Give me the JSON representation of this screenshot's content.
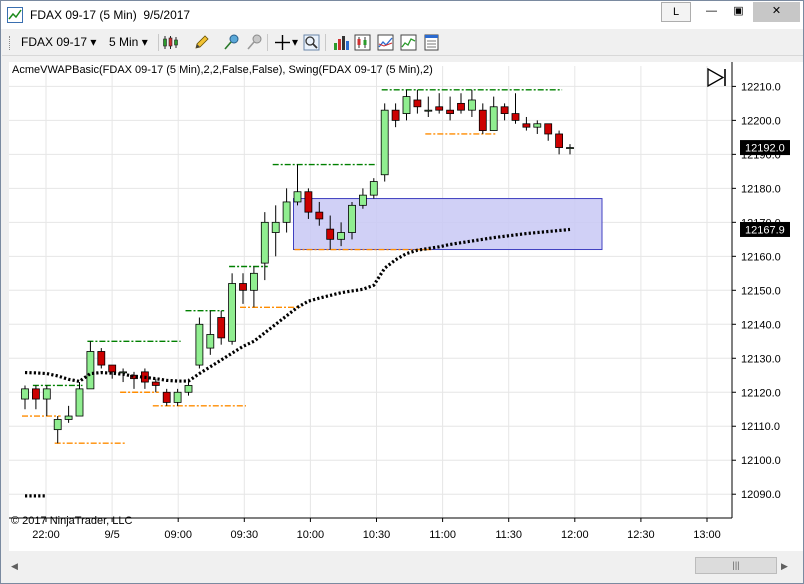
{
  "window": {
    "title_instrument": "FDAX 09-17 (5 Min)",
    "title_date": "9/5/2017",
    "button_l": "L",
    "minimize_glyph": "—",
    "maximize_glyph": "▣",
    "close_glyph": "✕"
  },
  "toolbar": {
    "instrument_label": "FDAX 09-17",
    "interval_label": "5 Min",
    "dropdown_glyph": "▾",
    "icons": [
      "candlestick-style-icon",
      "pencil-draw-icon",
      "pin-icon",
      "hide-draw-icon",
      "crosshair-icon",
      "zoom-icon",
      "bar-data-icon",
      "indicators-icon",
      "strategies-icon",
      "properties-icon"
    ]
  },
  "chart": {
    "indicator_label": "AcmeVWAPBasic(FDAX 09-17 (5 Min),2,2,False,False), Swing(FDAX 09-17 (5 Min),2)",
    "copyright": "© 2017 NinjaTrader, LLC",
    "last_price_label": "12192.0",
    "vwap_price_label": "12167.9",
    "colors": {
      "up_candle": "#90ee90",
      "down_candle": "#cc0000",
      "swing_high": "#008000",
      "swing_low": "#ff8c00",
      "vwap": "#000000",
      "zone_fill": "#c8c8f5",
      "zone_border": "#4040c0",
      "grid": "#e6e6e6"
    }
  },
  "chart_data": {
    "type": "candlestick",
    "instrument": "FDAX 09-17",
    "interval": "5 Min",
    "y_ticks": [
      12090,
      12100,
      12110,
      12120,
      12130,
      12140,
      12150,
      12160,
      12170,
      12180,
      12190,
      12200,
      12210
    ],
    "y_tick_labels": [
      "12090.0",
      "12100.0",
      "12110.0",
      "12120.0",
      "12130.0",
      "12140.0",
      "12150.0",
      "12160.0",
      "12170.0",
      "12180.0",
      "12190.0",
      "12200.0",
      "12210.0"
    ],
    "ylim": [
      12083,
      12216
    ],
    "x_ticks": [
      "22:00",
      "9/5",
      "09:00",
      "09:30",
      "10:00",
      "10:30",
      "11:00",
      "11:30",
      "12:00",
      "12:30",
      "13:00"
    ],
    "candles": [
      {
        "o": 12118,
        "h": 12122,
        "l": 12115,
        "c": 12121
      },
      {
        "o": 12121,
        "h": 12122,
        "l": 12115,
        "c": 12118
      },
      {
        "o": 12118,
        "h": 12122,
        "l": 12113,
        "c": 12121
      },
      {
        "o": 12109,
        "h": 12113,
        "l": 12105,
        "c": 12112
      },
      {
        "o": 12112,
        "h": 12116,
        "l": 12111,
        "c": 12113
      },
      {
        "o": 12113,
        "h": 12123,
        "l": 12113,
        "c": 12121
      },
      {
        "o": 12121,
        "h": 12135,
        "l": 12121,
        "c": 12132
      },
      {
        "o": 12132,
        "h": 12133,
        "l": 12127,
        "c": 12128
      },
      {
        "o": 12128,
        "h": 12128,
        "l": 12124,
        "c": 12126
      },
      {
        "o": 12126,
        "h": 12127,
        "l": 12123,
        "c": 12126
      },
      {
        "o": 12125,
        "h": 12126,
        "l": 12121,
        "c": 12124
      },
      {
        "o": 12126,
        "h": 12127,
        "l": 12121,
        "c": 12123
      },
      {
        "o": 12123,
        "h": 12124,
        "l": 12120,
        "c": 12122
      },
      {
        "o": 12120,
        "h": 12121,
        "l": 12116,
        "c": 12117
      },
      {
        "o": 12117,
        "h": 12121,
        "l": 12116,
        "c": 12120
      },
      {
        "o": 12120,
        "h": 12124,
        "l": 12119,
        "c": 12122
      },
      {
        "o": 12128,
        "h": 12142,
        "l": 12127,
        "c": 12140
      },
      {
        "o": 12133,
        "h": 12144,
        "l": 12131,
        "c": 12137
      },
      {
        "o": 12142,
        "h": 12144,
        "l": 12134,
        "c": 12136
      },
      {
        "o": 12135,
        "h": 12155,
        "l": 12134,
        "c": 12152
      },
      {
        "o": 12152,
        "h": 12155,
        "l": 12146,
        "c": 12150
      },
      {
        "o": 12150,
        "h": 12157,
        "l": 12145,
        "c": 12155
      },
      {
        "o": 12158,
        "h": 12173,
        "l": 12153,
        "c": 12170
      },
      {
        "o": 12167,
        "h": 12175,
        "l": 12160,
        "c": 12170
      },
      {
        "o": 12170,
        "h": 12180,
        "l": 12167,
        "c": 12176
      },
      {
        "o": 12176,
        "h": 12187,
        "l": 12175,
        "c": 12179
      },
      {
        "o": 12179,
        "h": 12180,
        "l": 12171,
        "c": 12173
      },
      {
        "o": 12173,
        "h": 12176,
        "l": 12169,
        "c": 12171
      },
      {
        "o": 12168,
        "h": 12172,
        "l": 12162,
        "c": 12165
      },
      {
        "o": 12165,
        "h": 12170,
        "l": 12163,
        "c": 12167
      },
      {
        "o": 12167,
        "h": 12176,
        "l": 12165,
        "c": 12175
      },
      {
        "o": 12175,
        "h": 12180,
        "l": 12174,
        "c": 12178
      },
      {
        "o": 12178,
        "h": 12183,
        "l": 12177,
        "c": 12182
      },
      {
        "o": 12184,
        "h": 12205,
        "l": 12182,
        "c": 12203
      },
      {
        "o": 12203,
        "h": 12205,
        "l": 12198,
        "c": 12200
      },
      {
        "o": 12202,
        "h": 12209,
        "l": 12200,
        "c": 12207
      },
      {
        "o": 12206,
        "h": 12209,
        "l": 12202,
        "c": 12204
      },
      {
        "o": 12203,
        "h": 12207,
        "l": 12201,
        "c": 12203
      },
      {
        "o": 12204,
        "h": 12208,
        "l": 12202,
        "c": 12203
      },
      {
        "o": 12203,
        "h": 12207,
        "l": 12200,
        "c": 12202
      },
      {
        "o": 12205,
        "h": 12208,
        "l": 12202,
        "c": 12203
      },
      {
        "o": 12203,
        "h": 12209,
        "l": 12201,
        "c": 12206
      },
      {
        "o": 12203,
        "h": 12205,
        "l": 12196,
        "c": 12197
      },
      {
        "o": 12197,
        "h": 12207,
        "l": 12197,
        "c": 12204
      },
      {
        "o": 12204,
        "h": 12205,
        "l": 12200,
        "c": 12202
      },
      {
        "o": 12202,
        "h": 12208,
        "l": 12199,
        "c": 12200
      },
      {
        "o": 12199,
        "h": 12201,
        "l": 12197,
        "c": 12198
      },
      {
        "o": 12198,
        "h": 12200,
        "l": 12196,
        "c": 12199
      },
      {
        "o": 12199,
        "h": 12199,
        "l": 12194,
        "c": 12196
      },
      {
        "o": 12196,
        "h": 12197,
        "l": 12190,
        "c": 12192
      },
      {
        "o": 12192,
        "h": 12193,
        "l": 12190,
        "c": 12192
      }
    ],
    "vwap": [
      12125.8,
      12125.7,
      12125.5,
      12124.8,
      12123.8,
      12123.2,
      12125.5,
      12125.8,
      12125.6,
      12125.3,
      12124.7,
      12124.4,
      12124.0,
      12123.5,
      12123.3,
      12123.3,
      12125.5,
      12127.5,
      12129.5,
      12131.5,
      12133.5,
      12135.0,
      12137.5,
      12140.0,
      12142.5,
      12145.0,
      12146.8,
      12147.7,
      12148.5,
      12149.3,
      12149.8,
      12150.3,
      12151.5,
      12156.5,
      12159.0,
      12160.8,
      12161.8,
      12162.3,
      12162.8,
      12163.5,
      12164.0,
      12164.5,
      12165.0,
      12165.5,
      12165.9,
      12166.3,
      12166.7,
      12167.0,
      12167.3,
      12167.6,
      12167.9
    ],
    "swing_highs": [
      {
        "price": 12122,
        "from": 1,
        "to": 5
      },
      {
        "price": 12135,
        "from": 6,
        "to": 14
      },
      {
        "price": 12144,
        "from": 15,
        "to": 18
      },
      {
        "price": 12157,
        "from": 19,
        "to": 22
      },
      {
        "price": 12187,
        "from": 23,
        "to": 32
      },
      {
        "price": 12209,
        "from": 33,
        "to": 49
      }
    ],
    "swing_lows": [
      {
        "price": 12113,
        "from": 0,
        "to": 3
      },
      {
        "price": 12105,
        "from": 3,
        "to": 9
      },
      {
        "price": 12120,
        "from": 9,
        "to": 12
      },
      {
        "price": 12116,
        "from": 12,
        "to": 20
      },
      {
        "price": 12145,
        "from": 20,
        "to": 25
      },
      {
        "price": 12162,
        "from": 25,
        "to": 37
      },
      {
        "price": 12196,
        "from": 37,
        "to": 43
      }
    ],
    "zone": {
      "from": 25,
      "to": 50,
      "price_low": 12162,
      "price_high": 12177
    },
    "last_price": 12192.0,
    "vwap_last": 12167.9
  }
}
